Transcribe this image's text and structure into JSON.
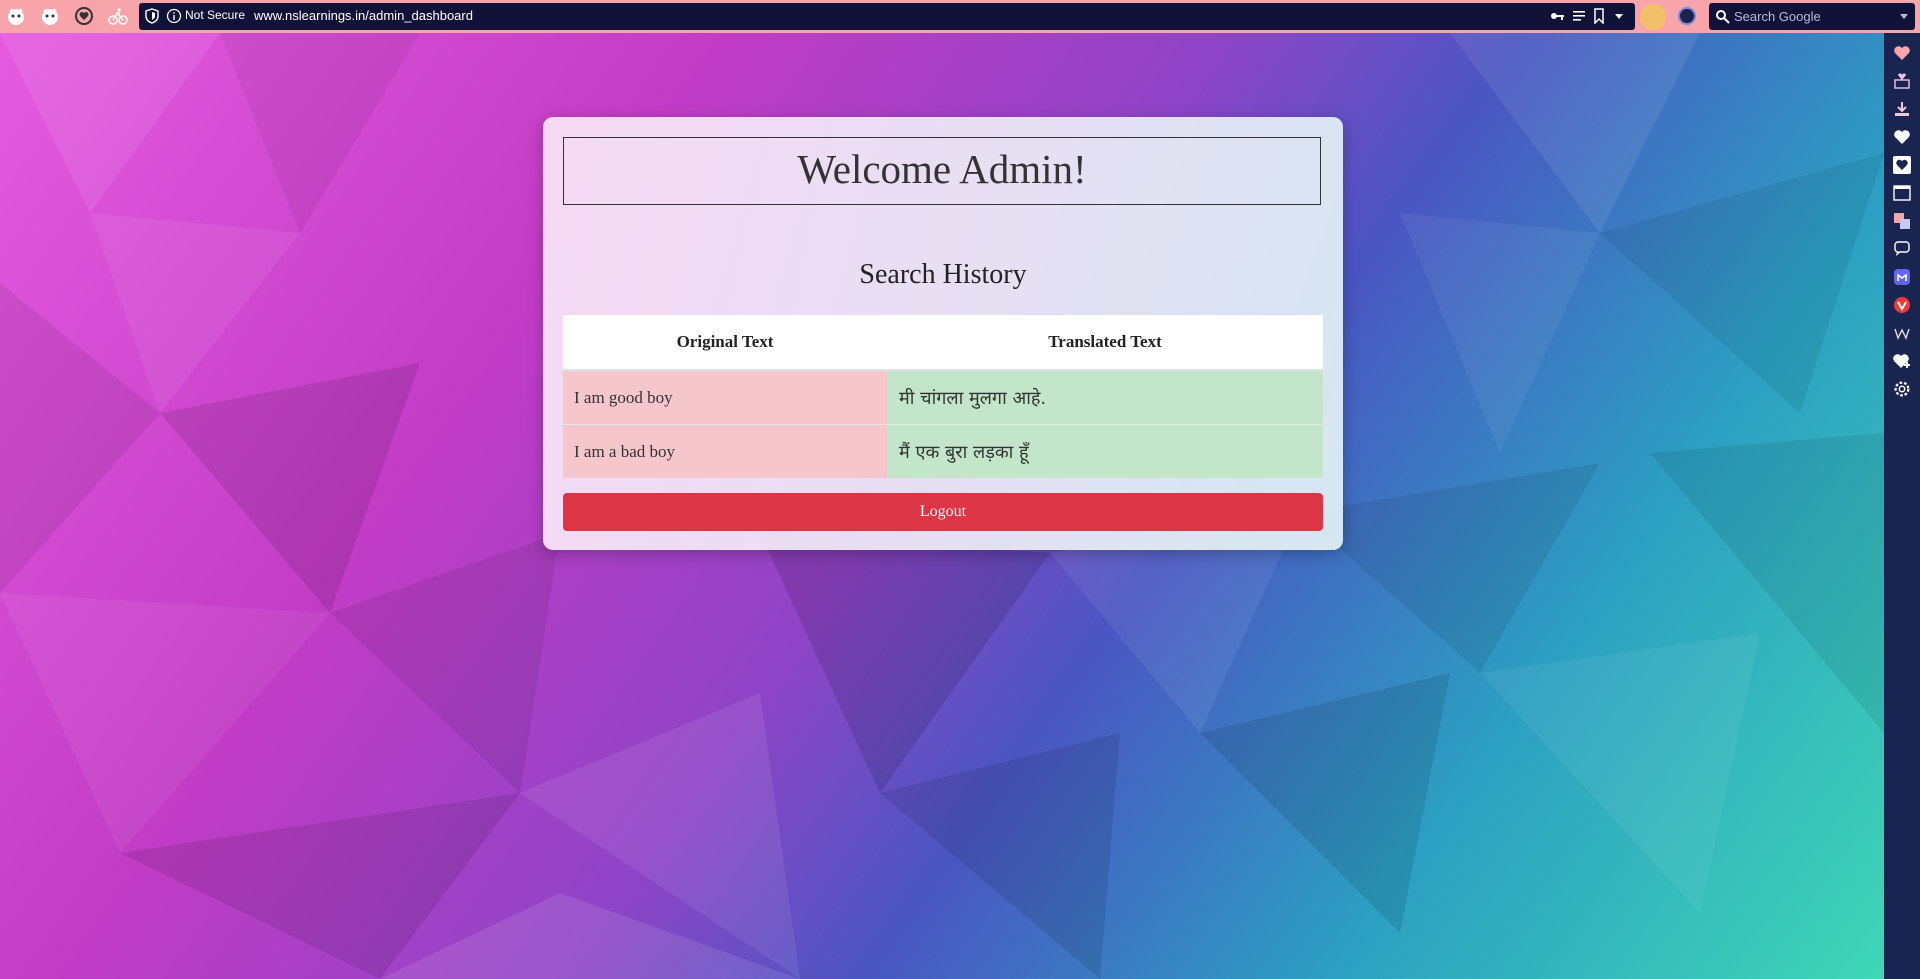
{
  "browser": {
    "security_label": "Not Secure",
    "url": "www.nslearnings.in/admin_dashboard",
    "search_placeholder": "Search Google",
    "accent_color": "#f7a5aa",
    "toolbar_color": "#111238",
    "tab_icons": [
      "cat-tab-icon",
      "cat-tab-icon",
      "heart-badge-tab-icon",
      "cyclist-tab-icon"
    ],
    "side_panel_icons": [
      "heart-icon",
      "gift-icon",
      "download-icon",
      "heart-icon",
      "heart-icon",
      "window-icon",
      "translate-icon",
      "chat-icon",
      "mastodon-icon",
      "vivaldi-icon",
      "wikipedia-icon",
      "heart-add-icon",
      "settings-icon"
    ]
  },
  "dashboard": {
    "title": "Welcome Admin!",
    "section_title": "Search History",
    "table": {
      "headers": [
        "Original Text",
        "Translated Text"
      ],
      "rows": [
        {
          "original": "I am good boy",
          "translated": "मी चांगला मुलगा आहे."
        },
        {
          "original": "I am a bad boy",
          "translated": "मैं एक बुरा लड़का हूँ"
        }
      ]
    },
    "logout_label": "Logout",
    "colors": {
      "original_cell": "#f5c6cb",
      "translated_cell": "#c3e6cb",
      "logout": "#dc3545"
    }
  }
}
